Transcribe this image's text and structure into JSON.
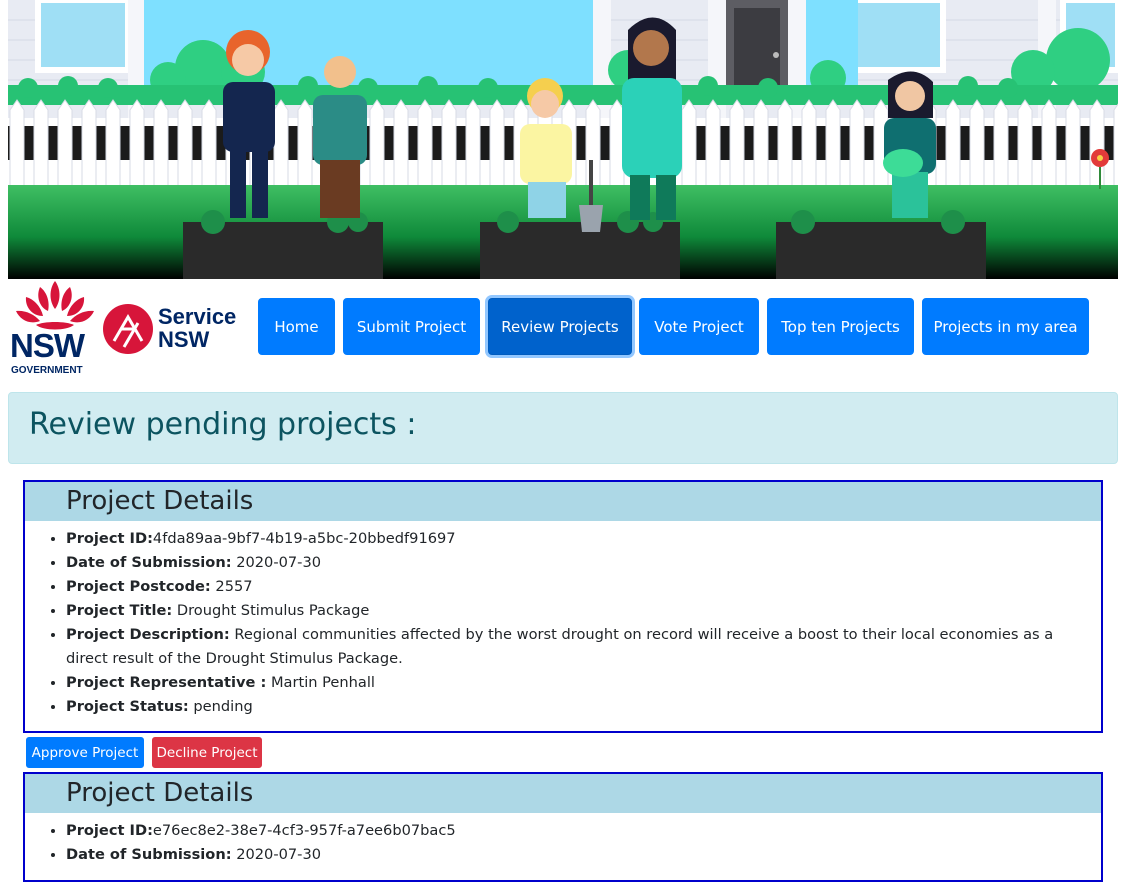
{
  "branding": {
    "nsw_text": "NSW",
    "nsw_subtext": "GOVERNMENT",
    "service_line1": "Service",
    "service_line2": "NSW"
  },
  "nav": {
    "items": [
      {
        "label": "Home",
        "active": false
      },
      {
        "label": "Submit Project",
        "active": false
      },
      {
        "label": "Review Projects",
        "active": true
      },
      {
        "label": "Vote Project",
        "active": false
      },
      {
        "label": "Top ten Projects",
        "active": false
      },
      {
        "label": "Projects in my area",
        "active": false
      }
    ]
  },
  "page": {
    "heading": "Review pending projects :"
  },
  "labels": {
    "details_heading": "Project Details",
    "id": "Project ID:",
    "date": "Date of Submission:",
    "postcode": "Project Postcode:",
    "title": "Project Title:",
    "description": "Project Description:",
    "representative": "Project Representative :",
    "status": "Project Status:"
  },
  "projects": [
    {
      "id": "4fda89aa-9bf7-4b19-a5bc-20bbedf91697",
      "date": "2020-07-30",
      "postcode": "2557",
      "title": "Drought Stimulus Package",
      "description": "Regional communities affected by the worst drought on record will receive a boost to their local economies as a direct result of the Drought Stimulus Package.",
      "representative": "Martin Penhall",
      "status": "pending"
    },
    {
      "id": "e76ec8e2-38e7-4cf3-957f-a7ee6b07bac5",
      "date": "2020-07-30"
    }
  ],
  "actions": {
    "approve": "Approve Project",
    "decline": "Decline Project"
  },
  "colors": {
    "primary": "#007bff",
    "danger": "#dc3545",
    "alert_bg": "#d1ecf1",
    "alert_text": "#0c5460",
    "details_bg": "#add8e6",
    "card_border": "#0000cc",
    "nsw_navy": "#002664",
    "nsw_red": "#d7153a"
  }
}
